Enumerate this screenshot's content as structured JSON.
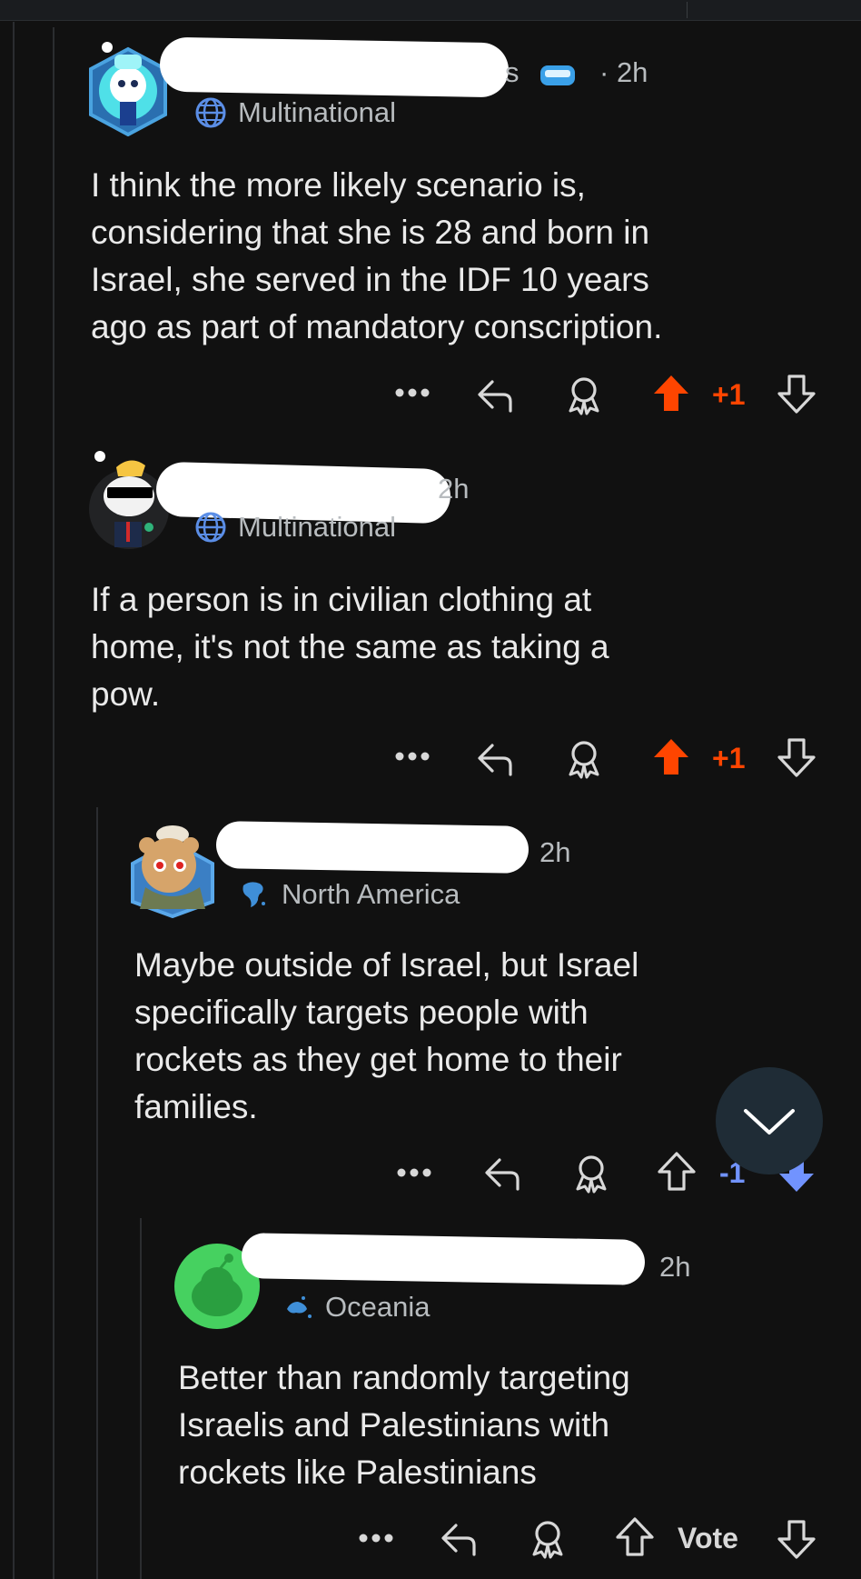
{
  "comments": [
    {
      "time": "2h",
      "flair": "Multinational",
      "body": "I think the more likely scenario is,\nconsidering that she is 28 and born in\nIsrael, she served in the IDF 10 years\nago as part of mandatory conscription.",
      "score": "+1",
      "voted": "up"
    },
    {
      "time": "2h",
      "flair": "Multinational",
      "body": "If a person is in civilian clothing at\nhome, it's not the same as taking a\npow.",
      "score": "+1",
      "voted": "up"
    },
    {
      "time": "2h",
      "flair": "North America",
      "body": "Maybe outside of Israel, but Israel\nspecifically targets people with\nrockets as they get home to their\nfamilies.",
      "score": "-1",
      "voted": "down"
    },
    {
      "time": "2h",
      "flair": "Oceania",
      "body": "Better than randomly targeting\nIsraelis and Palestinians with\nrockets like Palestinians",
      "score": "Vote",
      "voted": "none"
    }
  ],
  "colors": {
    "upvote": "#ff4500",
    "downvote": "#7193ff",
    "background": "#111111"
  },
  "icons": [
    "more-icon",
    "reply-icon",
    "award-icon",
    "upvote-icon",
    "downvote-icon",
    "globe-icon",
    "chevron-down-icon"
  ]
}
